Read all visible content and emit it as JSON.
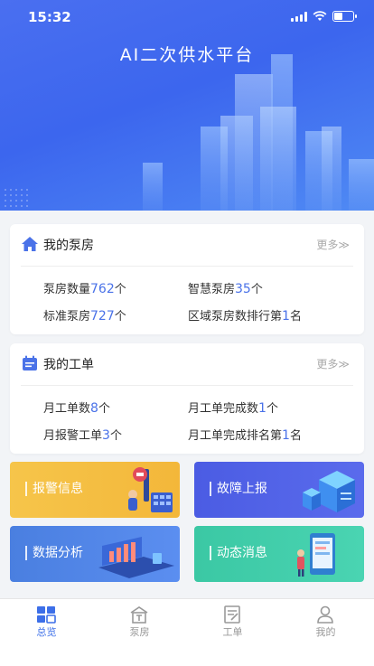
{
  "status_bar": {
    "time": "15:32"
  },
  "header": {
    "title": "AI二次供水平台"
  },
  "pump_card": {
    "title": "我的泵房",
    "more": "更多≫",
    "stats": [
      {
        "label": "泵房数量",
        "value": "762",
        "unit": "个"
      },
      {
        "label": "智慧泵房",
        "value": "35",
        "unit": "个"
      },
      {
        "label": "标准泵房",
        "value": "727",
        "unit": "个"
      },
      {
        "label": "区域泵房数排行第",
        "value": "1",
        "unit": "名"
      }
    ]
  },
  "order_card": {
    "title": "我的工单",
    "more": "更多≫",
    "stats": [
      {
        "label": "月工单数",
        "value": "8",
        "unit": "个"
      },
      {
        "label": "月工单完成数",
        "value": "1",
        "unit": "个"
      },
      {
        "label": "月报警工单",
        "value": "3",
        "unit": "个"
      },
      {
        "label": "月工单完成排名第",
        "value": "1",
        "unit": "名"
      }
    ]
  },
  "tiles": [
    {
      "label": "报警信息",
      "color": "#f5c040"
    },
    {
      "label": "故障上报",
      "color": "#4a5fe0"
    },
    {
      "label": "数据分析",
      "color": "#4a7fe0"
    },
    {
      "label": "动态消息",
      "color": "#3ec9a6"
    }
  ],
  "tabbar": {
    "active": 0,
    "items": [
      {
        "label": "总览",
        "icon": "grid-icon"
      },
      {
        "label": "泵房",
        "icon": "house-icon"
      },
      {
        "label": "工单",
        "icon": "clipboard-icon"
      },
      {
        "label": "我的",
        "icon": "user-icon"
      }
    ]
  },
  "colors": {
    "accent": "#3d6fe8",
    "hero": "#4a6ff0"
  }
}
